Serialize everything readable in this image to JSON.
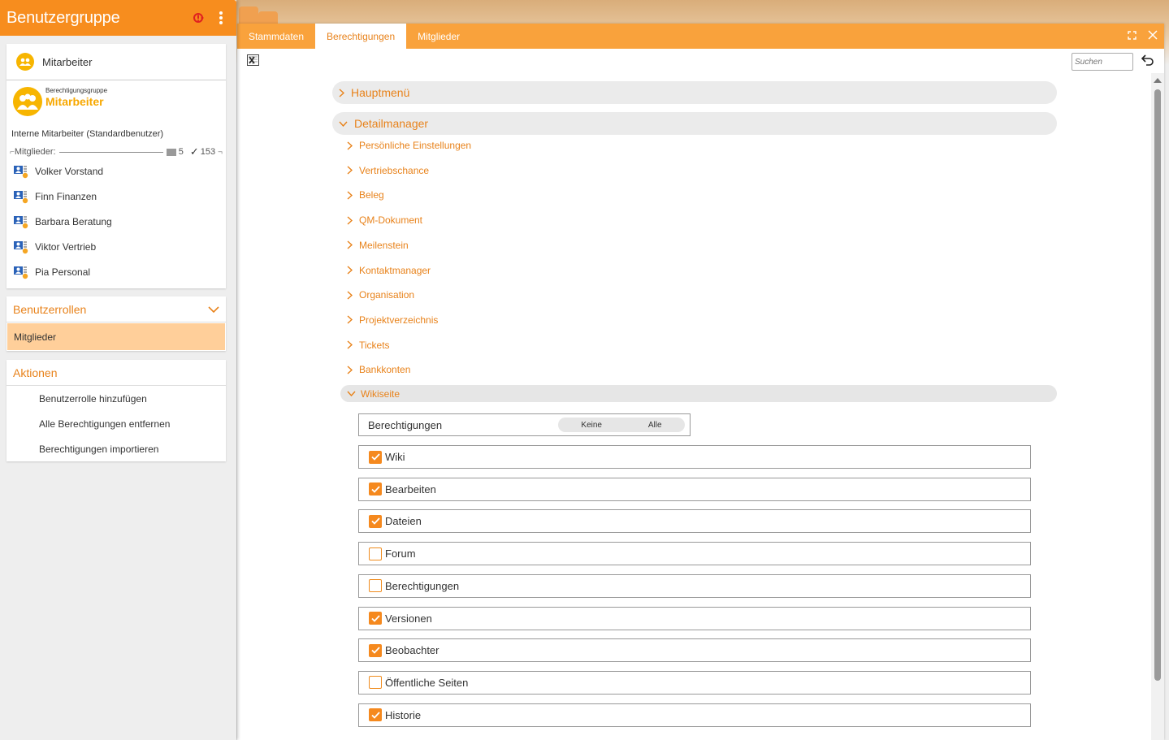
{
  "left": {
    "title": "Benutzergruppe",
    "group_name": "Mitarbeiter",
    "perm_group_label": "Berechtigungsgruppe",
    "perm_group_name": "Mitarbeiter",
    "description": "Interne Mitarbeiter (Standardbenutzer)",
    "members_label": "Mitglieder:",
    "members_count_a": "5",
    "members_count_b": "153",
    "members": [
      {
        "name": "Volker Vorstand"
      },
      {
        "name": "Finn Finanzen"
      },
      {
        "name": "Barbara Beratung"
      },
      {
        "name": "Viktor Vertrieb"
      },
      {
        "name": "Pia Personal"
      }
    ],
    "roles_header": "Benutzerrollen",
    "roles": [
      {
        "label": "Mitglieder"
      }
    ],
    "actions_header": "Aktionen",
    "actions": [
      {
        "label": "Benutzerrolle hinzufügen"
      },
      {
        "label": "Alle Berechtigungen entfernen"
      },
      {
        "label": "Berechtigungen importieren"
      }
    ]
  },
  "main": {
    "tabs": [
      {
        "label": "Stammdaten"
      },
      {
        "label": "Berechtigungen",
        "active": true
      },
      {
        "label": "Mitglieder"
      }
    ],
    "search_placeholder": "Suchen",
    "sections": [
      {
        "label": "Hauptmenü",
        "expanded": false
      },
      {
        "label": "Detailmanager",
        "expanded": true
      }
    ],
    "sub_items": [
      {
        "label": "Persönliche Einstellungen"
      },
      {
        "label": "Vertriebschance"
      },
      {
        "label": "Beleg"
      },
      {
        "label": "QM-Dokument"
      },
      {
        "label": "Meilenstein"
      },
      {
        "label": "Kontaktmanager"
      },
      {
        "label": "Organisation"
      },
      {
        "label": "Projektverzeichnis"
      },
      {
        "label": "Tickets"
      },
      {
        "label": "Bankkonten"
      }
    ],
    "wiki_label": "Wikiseite",
    "perm_header": {
      "label": "Berechtigungen",
      "none": "Keine",
      "all": "Alle"
    },
    "permissions": [
      {
        "label": "Wiki",
        "checked": true
      },
      {
        "label": "Bearbeiten",
        "checked": true
      },
      {
        "label": "Dateien",
        "checked": true
      },
      {
        "label": "Forum",
        "checked": false
      },
      {
        "label": "Berechtigungen",
        "checked": false
      },
      {
        "label": "Versionen",
        "checked": true
      },
      {
        "label": "Beobachter",
        "checked": true
      },
      {
        "label": "Öffentliche Seiten",
        "checked": false
      },
      {
        "label": "Historie",
        "checked": true
      }
    ]
  },
  "colors": {
    "accent": "#f78d1e",
    "tab_bar": "#f9a23c",
    "text_accent": "#e8821a",
    "selected": "#ffcf9a"
  }
}
